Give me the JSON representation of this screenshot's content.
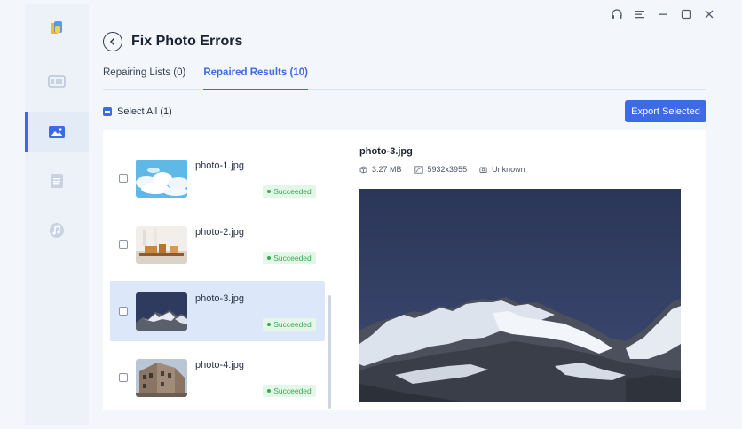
{
  "window": {
    "title": "Fix Photo Errors",
    "titlebar_icons": [
      "headset-icon",
      "menu-icon",
      "minimize-icon",
      "maximize-icon",
      "close-icon"
    ]
  },
  "sidebar": {
    "items": [
      {
        "name": "video",
        "icon": "video-icon",
        "active": false
      },
      {
        "name": "photo",
        "icon": "image-icon",
        "active": true
      },
      {
        "name": "document",
        "icon": "document-icon",
        "active": false
      },
      {
        "name": "audio",
        "icon": "music-icon",
        "active": false
      }
    ]
  },
  "tabs": [
    {
      "label": "Repairing Lists (0)",
      "active": false
    },
    {
      "label": "Repaired Results (10)",
      "active": true
    }
  ],
  "select_all_label": "Select All (1)",
  "export_label": "Export Selected",
  "files": [
    {
      "name": "photo-1.jpg",
      "status": "Succeeded",
      "checked": false,
      "selected": false
    },
    {
      "name": "photo-2.jpg",
      "status": "Succeeded",
      "checked": false,
      "selected": false
    },
    {
      "name": "photo-3.jpg",
      "status": "Succeeded",
      "checked": false,
      "selected": true
    },
    {
      "name": "photo-4.jpg",
      "status": "Succeeded",
      "checked": false,
      "selected": false
    }
  ],
  "preview": {
    "name": "photo-3.jpg",
    "size": "3.27 MB",
    "resolution": "5932x3955",
    "camera": "Unknown"
  },
  "colors": {
    "accent": "#3d6be6",
    "success": "#35a853",
    "success_bg": "#e4f6e8",
    "selected_row": "#dde7fa"
  }
}
